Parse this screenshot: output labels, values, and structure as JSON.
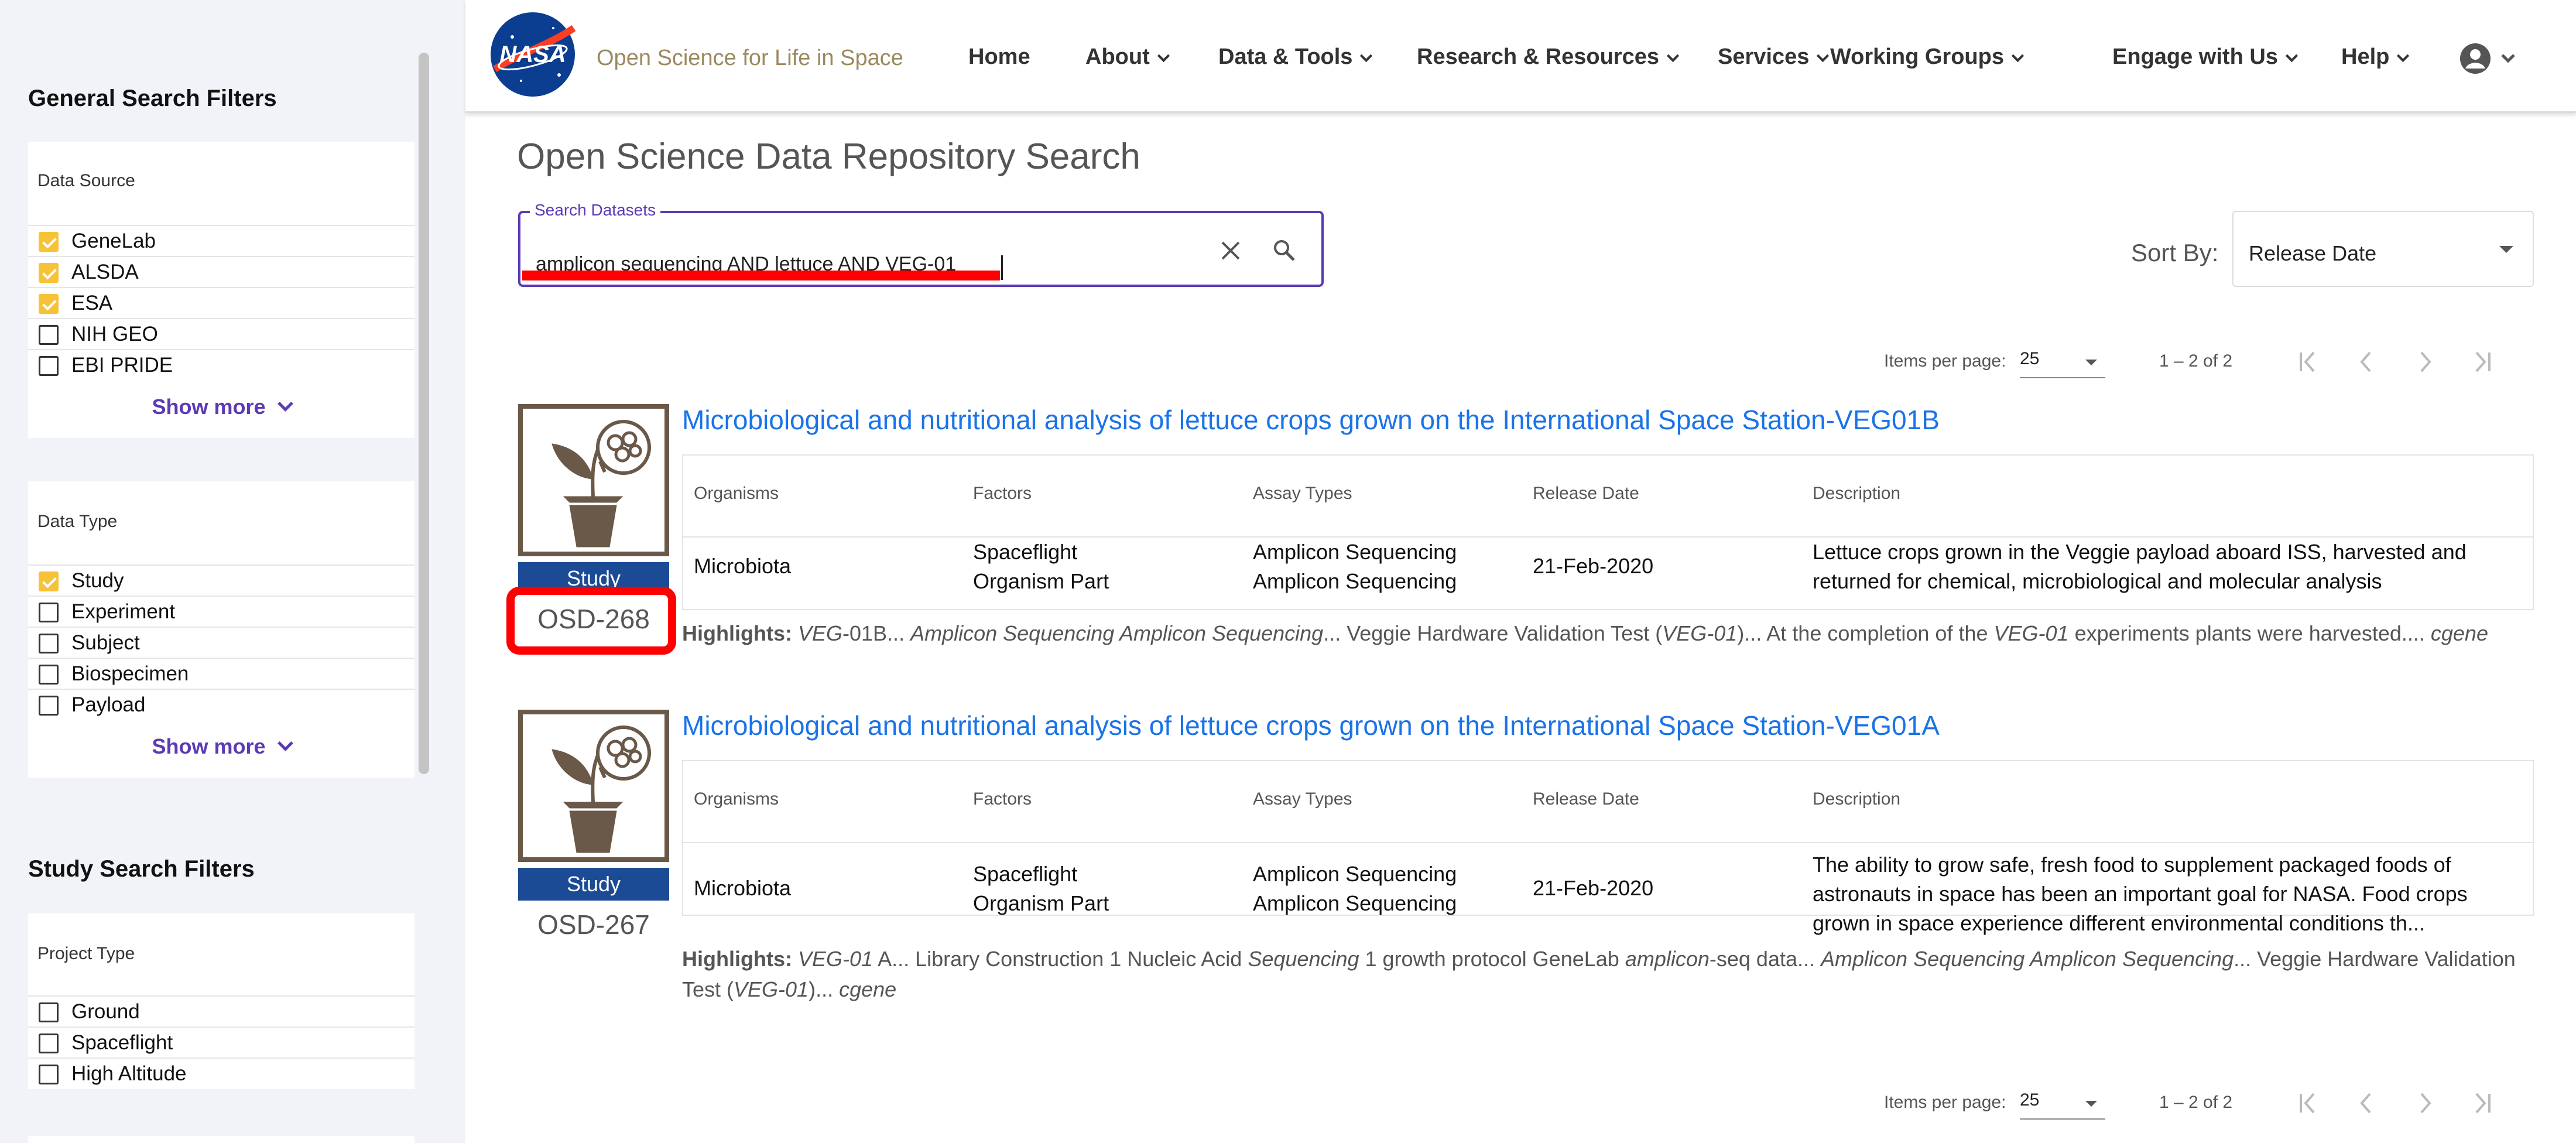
{
  "header": {
    "logo_text": "NASA",
    "site_name": "Open Science for Life in Space",
    "nav": [
      "Home",
      "About",
      "Data & Tools",
      "Research & Resources",
      "Services",
      "Working Groups",
      "Engage with Us",
      "Help"
    ]
  },
  "sidebar": {
    "general_title": "General Search Filters",
    "data_source": {
      "title": "Data Source",
      "items": [
        {
          "label": "GeneLab",
          "checked": true
        },
        {
          "label": "ALSDA",
          "checked": true
        },
        {
          "label": "ESA",
          "checked": true
        },
        {
          "label": "NIH GEO",
          "checked": false
        },
        {
          "label": "EBI PRIDE",
          "checked": false
        }
      ],
      "show_more": "Show more"
    },
    "data_type": {
      "title": "Data Type",
      "items": [
        {
          "label": "Study",
          "checked": true
        },
        {
          "label": "Experiment",
          "checked": false
        },
        {
          "label": "Subject",
          "checked": false
        },
        {
          "label": "Biospecimen",
          "checked": false
        },
        {
          "label": "Payload",
          "checked": false
        }
      ],
      "show_more": "Show more"
    },
    "study_title": "Study Search Filters",
    "project_type": {
      "title": "Project Type",
      "items": [
        {
          "label": "Ground",
          "checked": false
        },
        {
          "label": "Spaceflight",
          "checked": false
        },
        {
          "label": "High Altitude",
          "checked": false
        }
      ]
    }
  },
  "main": {
    "page_title": "Open Science Data Repository Search",
    "search": {
      "legend": "Search Datasets",
      "value": "amplicon sequencing AND lettuce AND VEG-01"
    },
    "sort": {
      "label": "Sort By:",
      "value": "Release Date"
    },
    "pager": {
      "items_label": "Items per page:",
      "per_page": "25",
      "range": "1 – 2 of 2"
    },
    "columns": [
      "Organisms",
      "Factors",
      "Assay Types",
      "Release Date",
      "Description"
    ],
    "results": [
      {
        "title": "Microbiological and nutritional analysis of lettuce crops grown on the International Space Station-VEG01B",
        "badge": "Study",
        "osd": "OSD-268",
        "organism": "Microbiota",
        "factors": [
          "Spaceflight",
          "Organism Part"
        ],
        "assays": [
          "Amplicon Sequencing",
          "Amplicon Sequencing"
        ],
        "release_date": "21-Feb-2020",
        "description": "Lettuce crops grown in the Veggie payload aboard ISS, harvested and returned for chemical, microbiological and molecular analysis",
        "highlights_label": "Highlights:",
        "highlights": [
          {
            "t": "VEG",
            "i": true
          },
          {
            "t": "-01B... ",
            "i": false
          },
          {
            "t": "Amplicon Sequencing Amplicon Sequencing",
            "i": true
          },
          {
            "t": "... Veggie Hardware Validation Test (",
            "i": false
          },
          {
            "t": "VEG-01",
            "i": true
          },
          {
            "t": ")... At the completion of the ",
            "i": false
          },
          {
            "t": "VEG-01",
            "i": true
          },
          {
            "t": " experiments plants were harvested.... ",
            "i": false
          },
          {
            "t": "cgene",
            "i": true
          }
        ]
      },
      {
        "title": "Microbiological and nutritional analysis of lettuce crops grown on the International Space Station-VEG01A",
        "badge": "Study",
        "osd": "OSD-267",
        "organism": "Microbiota",
        "factors": [
          "Spaceflight",
          "Organism Part"
        ],
        "assays": [
          "Amplicon Sequencing",
          "Amplicon Sequencing"
        ],
        "release_date": "21-Feb-2020",
        "description": "The ability to grow safe, fresh food to supplement packaged foods of astronauts in space has been an important goal for NASA. Food crops grown in space experience different environmental conditions th...",
        "highlights_label": "Highlights:",
        "highlights": [
          {
            "t": "VEG-01",
            "i": true
          },
          {
            "t": " A... Library Construction 1 Nucleic Acid ",
            "i": false
          },
          {
            "t": "Sequencing",
            "i": true
          },
          {
            "t": " 1 growth protocol GeneLab ",
            "i": false
          },
          {
            "t": "amplicon",
            "i": true
          },
          {
            "t": "-seq data... ",
            "i": false
          },
          {
            "t": "Amplicon Sequencing Amplicon Sequencing",
            "i": true
          },
          {
            "t": "... Veggie Hardware Validation Test (",
            "i": false
          },
          {
            "t": "VEG-01",
            "i": true
          },
          {
            "t": ")... ",
            "i": false
          },
          {
            "t": "cgene",
            "i": true
          }
        ]
      }
    ]
  },
  "colors": {
    "accent": "#5b3ab6",
    "link": "#1a73e8",
    "check": "#f6c338",
    "badge": "#1b4b94",
    "annotation": "#ff0000"
  }
}
